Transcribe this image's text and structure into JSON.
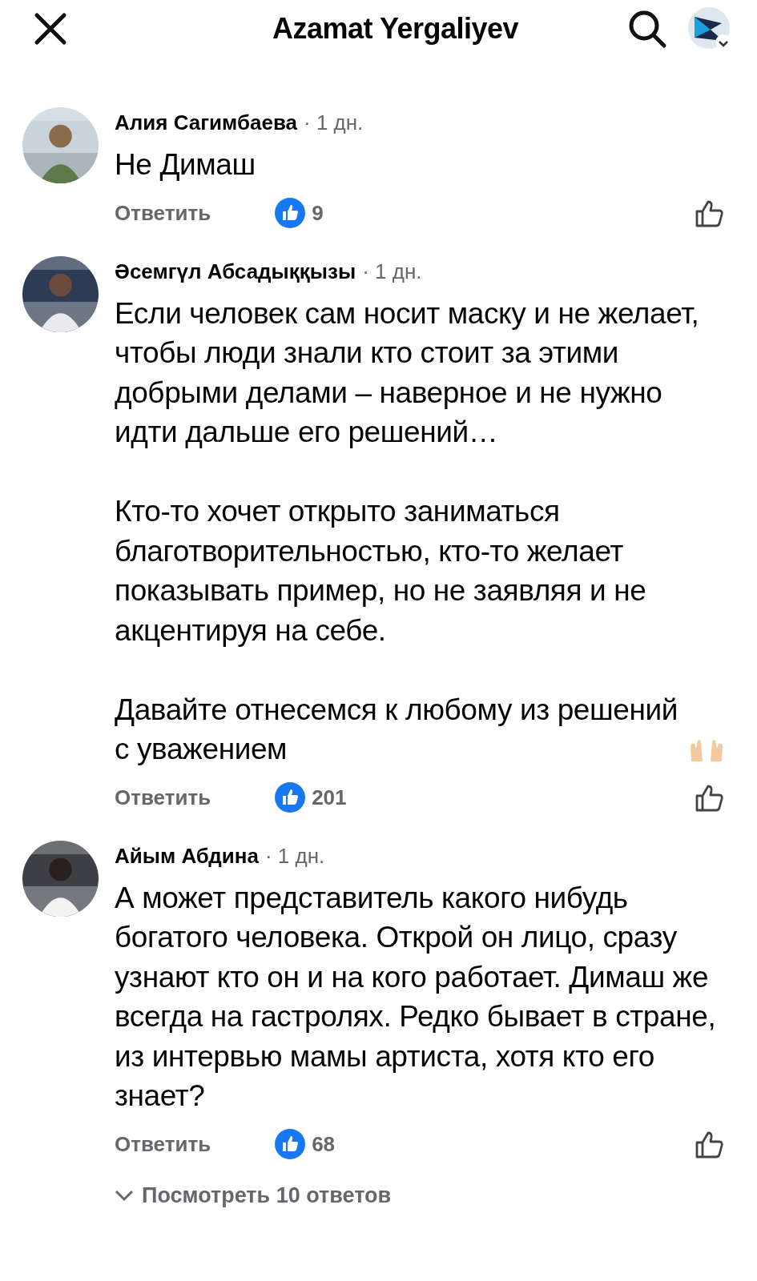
{
  "header": {
    "title": "Azamat Yergaliyev"
  },
  "comments": [
    {
      "author": "Алия Сагимбаева",
      "time": "· 1 дн.",
      "paragraphs": [
        {
          "text": "Не Димаш",
          "ends_with_emoji": false
        }
      ],
      "reply_label": "Ответить",
      "reactions": "9"
    },
    {
      "author": "Әсемгүл Абсадыққызы",
      "time": "· 1 дн.",
      "paragraphs": [
        {
          "text": "Если человек сам носит маску и не желает, чтобы люди знали кто стоит за этими добрыми делами – наверное и не нужно идти дальше его решений…",
          "ends_with_emoji": false
        },
        {
          "text": "Кто-то хочет открыто заниматься благотворительностью, кто-то желает показывать пример, но не заявляя и не акцентируя на себе.",
          "ends_with_emoji": false
        },
        {
          "text": "Давайте отнесемся к любому из решений с уважением",
          "ends_with_emoji": true
        }
      ],
      "reply_label": "Ответить",
      "reactions": "201"
    },
    {
      "author": "Айым Абдина",
      "time": "· 1 дн.",
      "paragraphs": [
        {
          "text": "А может представитель какого нибудь богатого человека. Открой он лицо, сразу узнают кто он и на кого работает. Димаш же всегда на гастролях. Редко бывает в стране, из интервью мамы артиста, хотя кто его знает?",
          "ends_with_emoji": false
        }
      ],
      "reply_label": "Ответить",
      "reactions": "68",
      "view_replies": "Посмотреть 10 ответов"
    }
  ]
}
